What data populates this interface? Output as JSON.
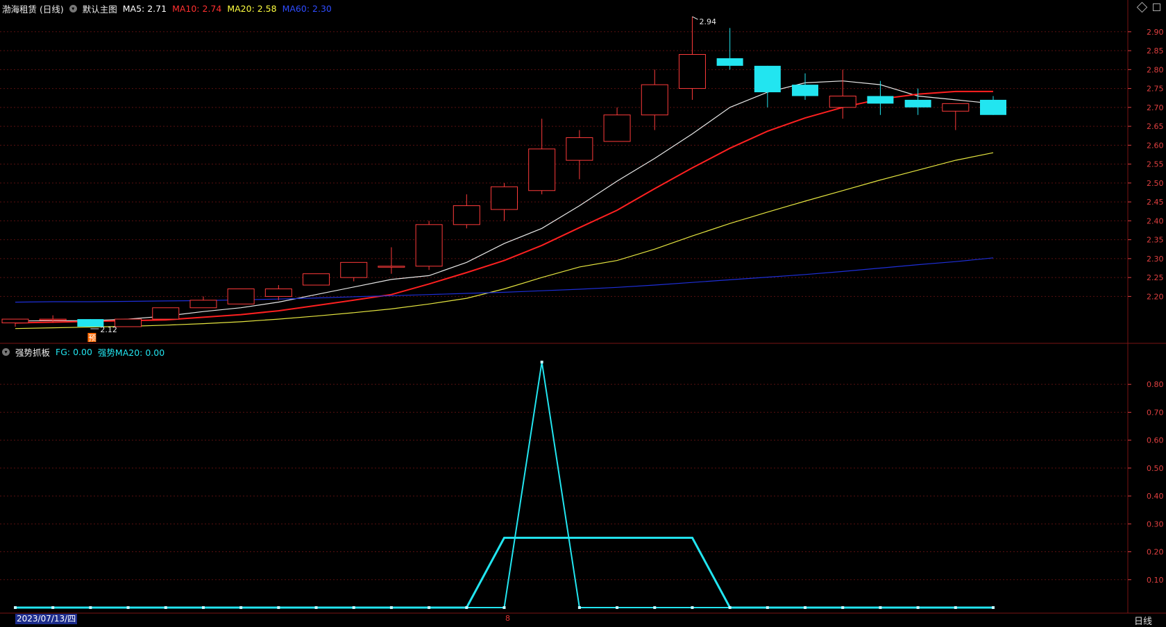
{
  "header": {
    "stock_title": "渤海租赁 (日线)",
    "main_chart_label": "默认主图",
    "ma_items": [
      {
        "label": "MA5: 2.71",
        "color": "#ffffff"
      },
      {
        "label": "MA10: 2.74",
        "color": "#ff3030"
      },
      {
        "label": "MA20: 2.58",
        "color": "#ffff40"
      },
      {
        "label": "MA60: 2.30",
        "color": "#2f4cff"
      }
    ]
  },
  "indicator_header": {
    "name": "强势抓板",
    "fg_label": "FG: 0.00",
    "ma20_label": "强势MA20: 0.00"
  },
  "price_axis": {
    "ticks": [
      "2.90",
      "2.85",
      "2.80",
      "2.75",
      "2.70",
      "2.65",
      "2.60",
      "2.55",
      "2.50",
      "2.45",
      "2.40",
      "2.35",
      "2.30",
      "2.25",
      "2.20"
    ],
    "values": [
      2.9,
      2.85,
      2.8,
      2.75,
      2.7,
      2.65,
      2.6,
      2.55,
      2.5,
      2.45,
      2.4,
      2.35,
      2.3,
      2.25,
      2.2
    ]
  },
  "indicator_axis": {
    "ticks": [
      "0.80",
      "0.70",
      "0.60",
      "0.50",
      "0.40",
      "0.30",
      "0.20",
      "0.10"
    ],
    "values": [
      0.8,
      0.7,
      0.6,
      0.5,
      0.4,
      0.3,
      0.2,
      0.1
    ]
  },
  "annotations": {
    "high_label": "2.94",
    "low_label": "2.12",
    "pre_badge": "预"
  },
  "footer": {
    "date": "2023/07/13/四",
    "mid_mark": "8",
    "period": "日线"
  },
  "colors": {
    "up": "#ff3b3b",
    "down": "#22e5f0",
    "ma5": "#e8e8e8",
    "ma10": "#ff2020",
    "ma20": "#e6e640",
    "ma60": "#1e2fd8",
    "grid": "#5a1010",
    "axis_text": "#e04040"
  },
  "chart_data": [
    {
      "type": "candlestick",
      "candles": [
        {
          "o": 2.13,
          "h": 2.14,
          "l": 2.12,
          "c": 2.14
        },
        {
          "o": 2.14,
          "h": 2.15,
          "l": 2.13,
          "c": 2.14
        },
        {
          "o": 2.14,
          "h": 2.14,
          "l": 2.12,
          "c": 2.12
        },
        {
          "o": 2.12,
          "h": 2.14,
          "l": 2.12,
          "c": 2.14
        },
        {
          "o": 2.14,
          "h": 2.17,
          "l": 2.14,
          "c": 2.17
        },
        {
          "o": 2.17,
          "h": 2.2,
          "l": 2.17,
          "c": 2.19
        },
        {
          "o": 2.18,
          "h": 2.22,
          "l": 2.18,
          "c": 2.22
        },
        {
          "o": 2.2,
          "h": 2.23,
          "l": 2.19,
          "c": 2.22
        },
        {
          "o": 2.23,
          "h": 2.26,
          "l": 2.23,
          "c": 2.26
        },
        {
          "o": 2.25,
          "h": 2.29,
          "l": 2.24,
          "c": 2.29
        },
        {
          "o": 2.28,
          "h": 2.33,
          "l": 2.26,
          "c": 2.28
        },
        {
          "o": 2.28,
          "h": 2.4,
          "l": 2.27,
          "c": 2.39
        },
        {
          "o": 2.39,
          "h": 2.47,
          "l": 2.38,
          "c": 2.44
        },
        {
          "o": 2.43,
          "h": 2.5,
          "l": 2.4,
          "c": 2.49
        },
        {
          "o": 2.48,
          "h": 2.67,
          "l": 2.47,
          "c": 2.59
        },
        {
          "o": 2.56,
          "h": 2.64,
          "l": 2.51,
          "c": 2.62
        },
        {
          "o": 2.61,
          "h": 2.7,
          "l": 2.61,
          "c": 2.68
        },
        {
          "o": 2.68,
          "h": 2.8,
          "l": 2.64,
          "c": 2.76
        },
        {
          "o": 2.75,
          "h": 2.94,
          "l": 2.72,
          "c": 2.84
        },
        {
          "o": 2.83,
          "h": 2.91,
          "l": 2.8,
          "c": 2.81
        },
        {
          "o": 2.81,
          "h": 2.81,
          "l": 2.7,
          "c": 2.74
        },
        {
          "o": 2.76,
          "h": 2.79,
          "l": 2.72,
          "c": 2.73
        },
        {
          "o": 2.7,
          "h": 2.8,
          "l": 2.67,
          "c": 2.73
        },
        {
          "o": 2.73,
          "h": 2.77,
          "l": 2.68,
          "c": 2.71
        },
        {
          "o": 2.72,
          "h": 2.75,
          "l": 2.68,
          "c": 2.7
        },
        {
          "o": 2.69,
          "h": 2.71,
          "l": 2.64,
          "c": 2.71
        },
        {
          "o": 2.72,
          "h": 2.73,
          "l": 2.68,
          "c": 2.68
        }
      ],
      "series": [
        {
          "name": "MA5",
          "values": [
            2.135,
            2.136,
            2.136,
            2.14,
            2.148,
            2.16,
            2.17,
            2.185,
            2.205,
            2.225,
            2.245,
            2.255,
            2.29,
            2.34,
            2.38,
            2.44,
            2.505,
            2.565,
            2.63,
            2.7,
            2.74,
            2.765,
            2.77,
            2.76,
            2.73,
            2.72,
            2.71
          ]
        },
        {
          "name": "MA10",
          "values": [
            2.13,
            2.132,
            2.134,
            2.136,
            2.138,
            2.145,
            2.152,
            2.162,
            2.176,
            2.19,
            2.205,
            2.233,
            2.263,
            2.295,
            2.335,
            2.382,
            2.428,
            2.485,
            2.54,
            2.592,
            2.637,
            2.672,
            2.7,
            2.722,
            2.735,
            2.742,
            2.742
          ]
        },
        {
          "name": "MA20",
          "values": [
            2.115,
            2.117,
            2.119,
            2.121,
            2.124,
            2.128,
            2.133,
            2.14,
            2.148,
            2.157,
            2.167,
            2.18,
            2.195,
            2.22,
            2.25,
            2.278,
            2.295,
            2.325,
            2.36,
            2.393,
            2.423,
            2.452,
            2.48,
            2.508,
            2.534,
            2.56,
            2.58
          ]
        },
        {
          "name": "MA60",
          "values": [
            2.185,
            2.186,
            2.186,
            2.187,
            2.188,
            2.189,
            2.191,
            2.193,
            2.196,
            2.199,
            2.202,
            2.205,
            2.208,
            2.211,
            2.215,
            2.219,
            2.224,
            2.23,
            2.237,
            2.244,
            2.251,
            2.258,
            2.266,
            2.275,
            2.284,
            2.292,
            2.302
          ]
        }
      ],
      "ylim": [
        2.12,
        2.95
      ]
    },
    {
      "type": "line",
      "series": [
        {
          "name": "FG",
          "values": [
            0,
            0,
            0,
            0,
            0,
            0,
            0,
            0,
            0,
            0,
            0,
            0,
            0,
            0,
            0.88,
            0,
            0,
            0,
            0,
            0,
            0,
            0,
            0,
            0,
            0,
            0,
            0
          ]
        },
        {
          "name": "强势MA20",
          "values": [
            0,
            0,
            0,
            0,
            0,
            0,
            0,
            0,
            0,
            0,
            0,
            0,
            0,
            0.25,
            0.25,
            0.25,
            0.25,
            0.25,
            0.25,
            0,
            0,
            0,
            0,
            0,
            0,
            0,
            0
          ]
        }
      ],
      "ylim": [
        0,
        0.9
      ]
    }
  ]
}
